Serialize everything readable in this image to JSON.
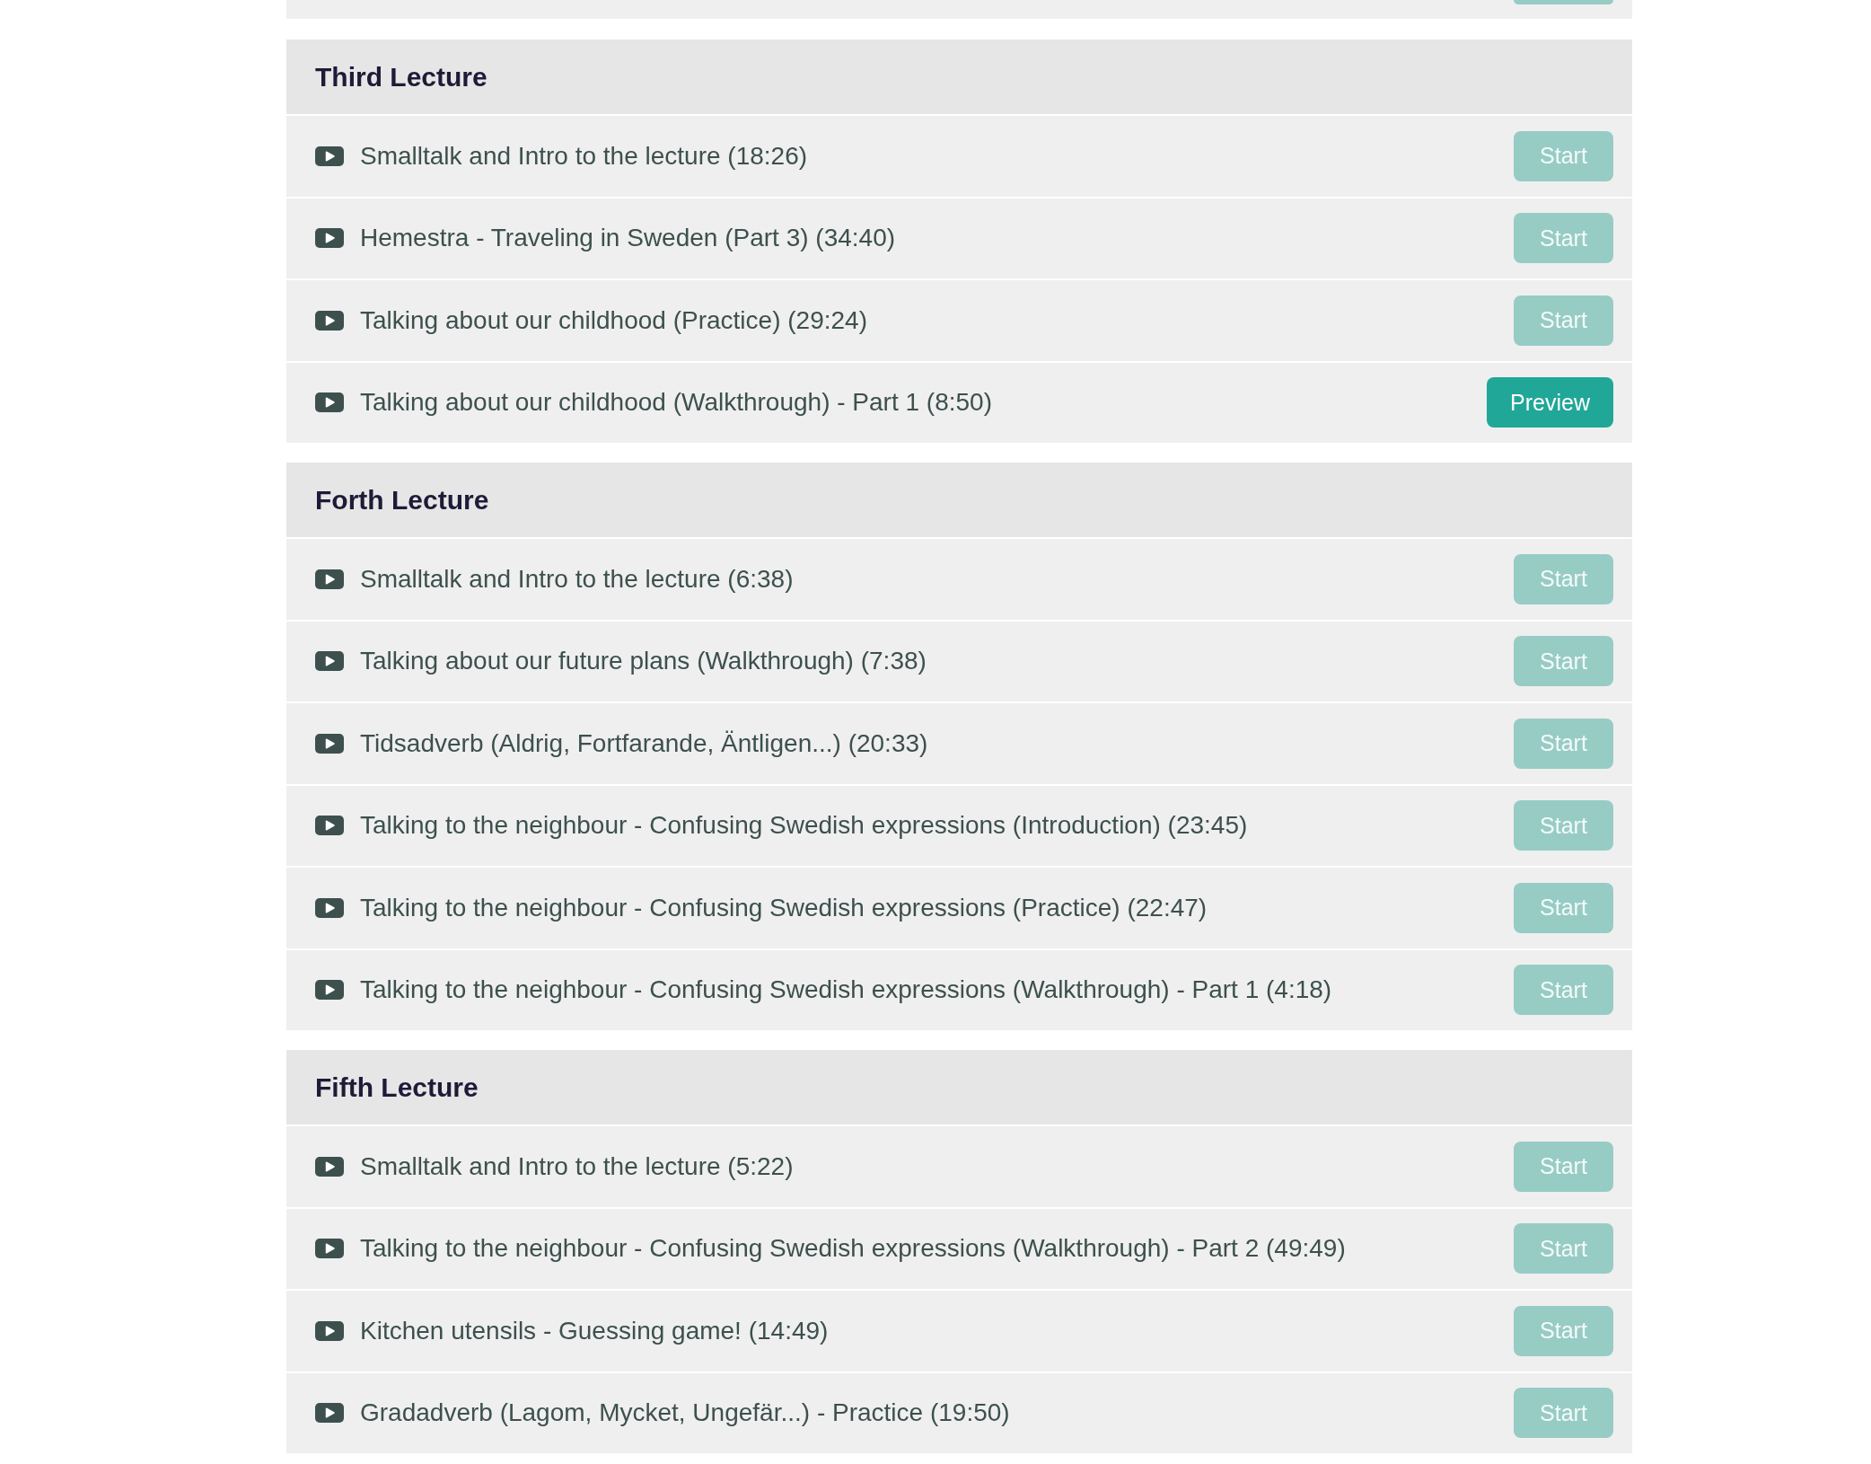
{
  "sections": [
    {
      "title": "Third Lecture",
      "lessons": [
        {
          "title": "Smalltalk and Intro to the lecture (18:26)",
          "button": {
            "label": "Start",
            "disabled": true
          }
        },
        {
          "title": "Hemestra - Traveling in Sweden (Part 3) (34:40)",
          "button": {
            "label": "Start",
            "disabled": true
          }
        },
        {
          "title": "Talking about our childhood (Practice) (29:24)",
          "button": {
            "label": "Start",
            "disabled": true
          }
        },
        {
          "title": "Talking about our childhood (Walkthrough) - Part 1 (8:50)",
          "button": {
            "label": "Preview",
            "disabled": false
          }
        }
      ]
    },
    {
      "title": "Forth Lecture",
      "lessons": [
        {
          "title": "Smalltalk and Intro to the lecture (6:38)",
          "button": {
            "label": "Start",
            "disabled": true
          }
        },
        {
          "title": "Talking about our future plans (Walkthrough) (7:38)",
          "button": {
            "label": "Start",
            "disabled": true
          }
        },
        {
          "title": "Tidsadverb (Aldrig, Fortfarande, Äntligen...) (20:33)",
          "button": {
            "label": "Start",
            "disabled": true
          }
        },
        {
          "title": "Talking to the neighbour - Confusing Swedish expressions (Introduction) (23:45)",
          "button": {
            "label": "Start",
            "disabled": true
          }
        },
        {
          "title": "Talking to the neighbour - Confusing Swedish expressions (Practice) (22:47)",
          "button": {
            "label": "Start",
            "disabled": true
          }
        },
        {
          "title": "Talking to the neighbour - Confusing Swedish expressions (Walkthrough) - Part 1 (4:18)",
          "button": {
            "label": "Start",
            "disabled": true
          }
        }
      ]
    },
    {
      "title": "Fifth Lecture",
      "lessons": [
        {
          "title": "Smalltalk and Intro to the lecture (5:22)",
          "button": {
            "label": "Start",
            "disabled": true
          }
        },
        {
          "title": "Talking to the neighbour - Confusing Swedish expressions (Walkthrough) - Part 2 (49:49)",
          "button": {
            "label": "Start",
            "disabled": true
          }
        },
        {
          "title": "Kitchen utensils - Guessing game! (14:49)",
          "button": {
            "label": "Start",
            "disabled": true
          }
        },
        {
          "title": "Gradadverb (Lagom, Mycket, Ungefär...) - Practice (19:50)",
          "button": {
            "label": "Start",
            "disabled": true
          }
        }
      ]
    }
  ]
}
